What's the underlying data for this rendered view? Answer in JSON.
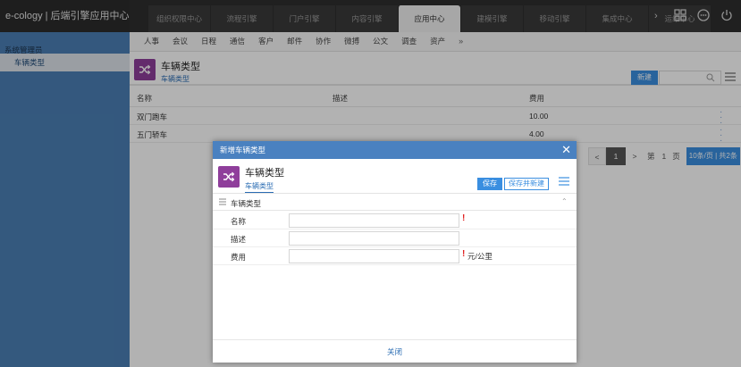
{
  "app": {
    "title": "e-cology | 后端引擎应用中心"
  },
  "top_tabs": [
    {
      "label": "组织权限中心",
      "active": false
    },
    {
      "label": "流程引擎",
      "active": false
    },
    {
      "label": "门户引擎",
      "active": false
    },
    {
      "label": "内容引擎",
      "active": false
    },
    {
      "label": "应用中心",
      "active": true
    },
    {
      "label": "建模引擎",
      "active": false
    },
    {
      "label": "移动引擎",
      "active": false
    },
    {
      "label": "集成中心",
      "active": false
    },
    {
      "label": "运维中心",
      "active": false
    }
  ],
  "top_icons": [
    "grid-icon",
    "more-icon",
    "power-icon",
    "chevron-right-icon"
  ],
  "sidebar": {
    "title": "系统管理员",
    "items": [
      {
        "label": "车辆类型",
        "selected": true
      }
    ]
  },
  "subnav": {
    "items": [
      "人事",
      "会议",
      "日程",
      "通信",
      "客户",
      "邮件",
      "协作",
      "微搏",
      "公文",
      "调查",
      "资产"
    ],
    "more": "»"
  },
  "page": {
    "title": "车辆类型",
    "subtitle": "车辆类型",
    "new_button": "新建",
    "search_placeholder": ""
  },
  "table": {
    "headers": [
      "名称",
      "描述",
      "费用"
    ],
    "rows": [
      {
        "name": "双门跑车",
        "desc": "",
        "cost": "10.00"
      },
      {
        "name": "五门轿车",
        "desc": "",
        "cost": "4.00"
      }
    ]
  },
  "pager": {
    "prev": "<",
    "current": "1",
    "next": ">",
    "di": "第",
    "page_input": "1",
    "ye": "页",
    "info": "10条/页 | 共2条"
  },
  "modal": {
    "header": "新增车辆类型",
    "close": "✕",
    "title": "车辆类型",
    "subtitle": "车辆类型",
    "save": "保存",
    "save_new": "保存并新建",
    "section": "车辆类型",
    "fields": [
      {
        "label": "名称",
        "value": "",
        "required": true,
        "unit": ""
      },
      {
        "label": "描述",
        "value": "",
        "required": false,
        "unit": ""
      },
      {
        "label": "费用",
        "value": "",
        "required": true,
        "unit": "元/公里"
      }
    ],
    "footer": "关闭"
  },
  "colors": {
    "accent": "#3a8ee0",
    "sidebar": "#4b7fb5",
    "app_icon": "#8f3e9b",
    "modal_header": "#4a81c0",
    "topbar": "#2f2f2f"
  }
}
